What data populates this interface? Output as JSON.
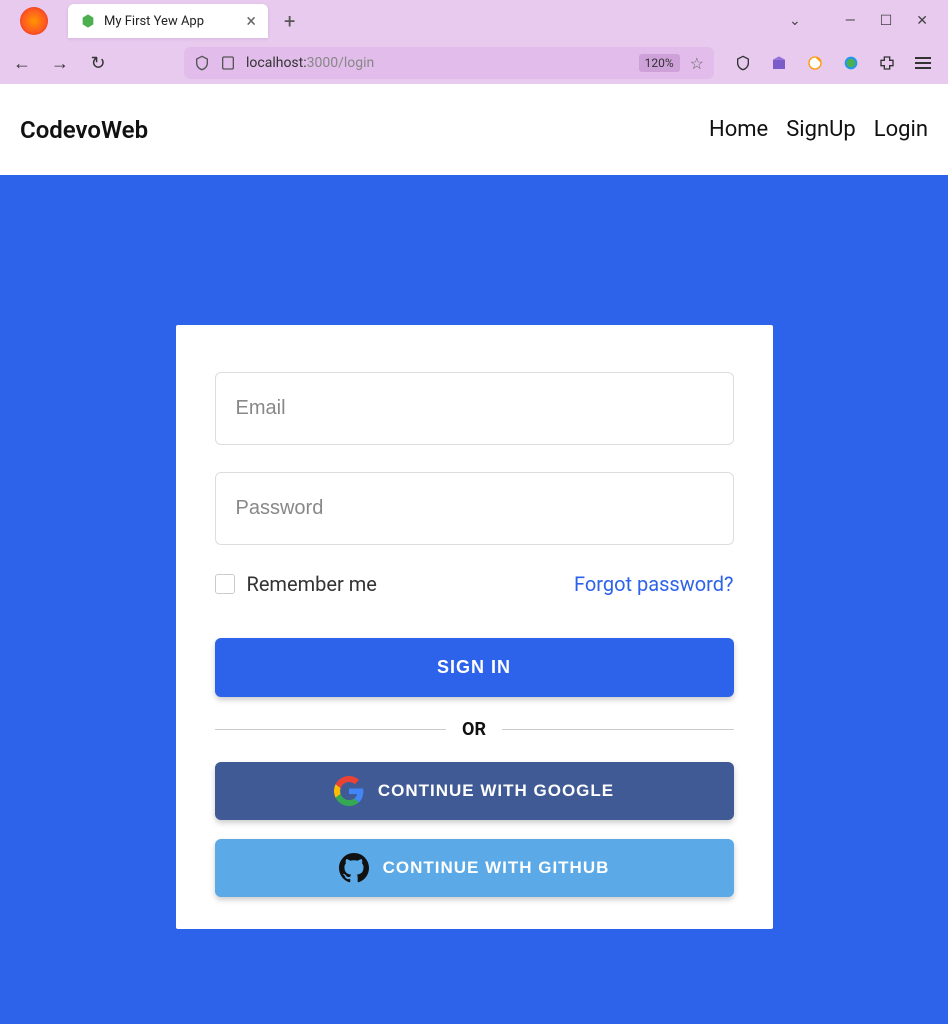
{
  "browser": {
    "tab_title": "My First Yew App",
    "url_host": "localhost:",
    "url_path": "3000/login",
    "zoom": "120%"
  },
  "header": {
    "brand": "CodevoWeb",
    "nav": [
      "Home",
      "SignUp",
      "Login"
    ]
  },
  "form": {
    "email_placeholder": "Email",
    "password_placeholder": "Password",
    "remember_label": "Remember me",
    "forgot_label": "Forgot password?",
    "signin_label": "SIGN IN",
    "divider": "OR",
    "google_label": "CONTINUE WITH GOOGLE",
    "github_label": "CONTINUE WITH GITHUB"
  }
}
